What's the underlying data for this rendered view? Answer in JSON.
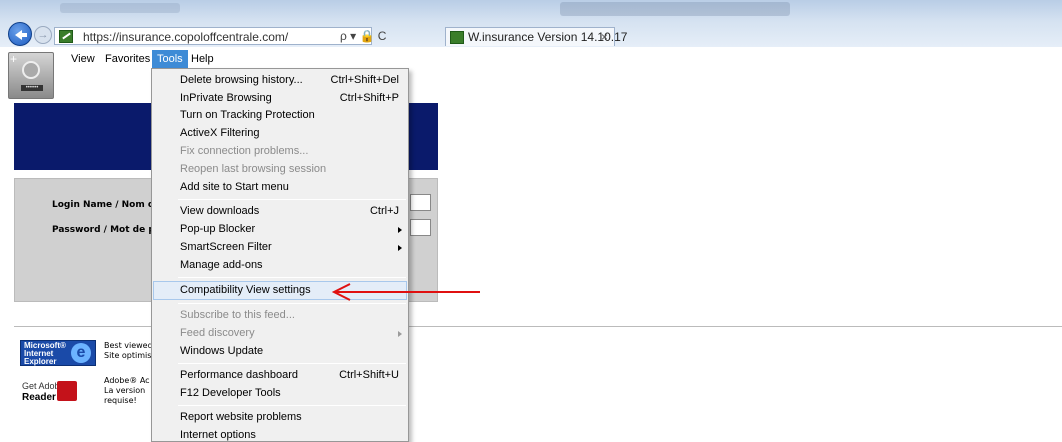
{
  "window": {
    "title": "",
    "address_url": "https://insurance.copoloffcentrale.com/",
    "address_controls": "ρ ▾ 🔒 C",
    "tab_title": "W.insurance Version 14.10.17",
    "tab_close": "×",
    "back_icon": "back-arrow-icon",
    "forward_icon": "forward-arrow-icon",
    "forward_glyph": "→"
  },
  "menubar": {
    "items": [
      {
        "label": "View"
      },
      {
        "label": "Favorites"
      },
      {
        "label": "Tools"
      },
      {
        "label": "Help"
      }
    ]
  },
  "page": {
    "banner_fragment": "(",
    "login_label": "Login Name / Nom d'u",
    "password_label": "Password / Mot de pa",
    "ie_badge_text": "Microsoft® Internet Explorer",
    "ie_badge_letter": "e",
    "ie_text_line1": "Best viewed",
    "ie_text_line2": "Site optimis",
    "adobe_badge_get": "Get Adobe",
    "adobe_badge_reader": "Reader",
    "adobe_text_line1": "Adobe® Ac",
    "adobe_text_line2": "La version",
    "adobe_text_line3": "requise!",
    "fav_dots": "••••••",
    "fav_plus": "+"
  },
  "tools_menu": {
    "items": [
      {
        "label": "Delete browsing history...",
        "shortcut": "Ctrl+Shift+Del",
        "disabled": false
      },
      {
        "label": "InPrivate Browsing",
        "shortcut": "Ctrl+Shift+P",
        "disabled": false
      },
      {
        "label": "Turn on Tracking Protection",
        "shortcut": "",
        "disabled": false
      },
      {
        "label": "ActiveX Filtering",
        "shortcut": "",
        "disabled": false
      },
      {
        "label": "Fix connection problems...",
        "shortcut": "",
        "disabled": true
      },
      {
        "label": "Reopen last browsing session",
        "shortcut": "",
        "disabled": true
      },
      {
        "label": "Add site to Start menu",
        "shortcut": "",
        "disabled": false
      },
      {
        "label": "View downloads",
        "shortcut": "Ctrl+J",
        "disabled": false
      },
      {
        "label": "Pop-up Blocker",
        "shortcut": "",
        "disabled": false,
        "submenu": true
      },
      {
        "label": "SmartScreen Filter",
        "shortcut": "",
        "disabled": false,
        "submenu": true
      },
      {
        "label": "Manage add-ons",
        "shortcut": "",
        "disabled": false
      },
      {
        "label": "Compatibility View settings",
        "shortcut": "",
        "disabled": false,
        "highlighted": true
      },
      {
        "label": "Subscribe to this feed...",
        "shortcut": "",
        "disabled": true
      },
      {
        "label": "Feed discovery",
        "shortcut": "",
        "disabled": true,
        "submenu": true
      },
      {
        "label": "Windows Update",
        "shortcut": "",
        "disabled": false
      },
      {
        "label": "Performance dashboard",
        "shortcut": "Ctrl+Shift+U",
        "disabled": false
      },
      {
        "label": "F12 Developer Tools",
        "shortcut": "",
        "disabled": false
      },
      {
        "label": "Report website problems",
        "shortcut": "",
        "disabled": false
      },
      {
        "label": "Internet options",
        "shortcut": "",
        "disabled": false
      }
    ]
  },
  "colors": {
    "menu_active": "#3e8bd6",
    "banner_navy": "#0a1a6b",
    "annotation_red": "#e01010"
  }
}
